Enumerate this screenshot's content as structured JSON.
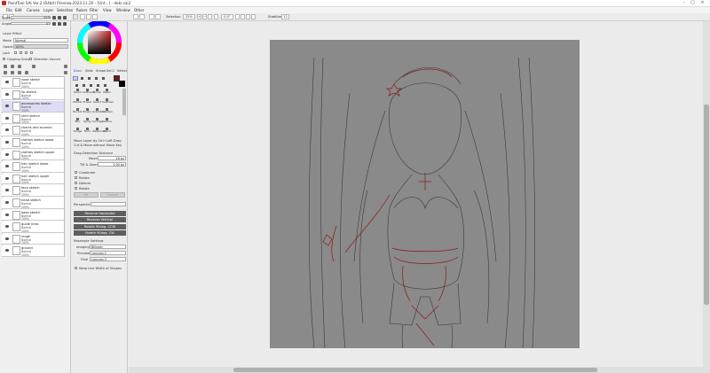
{
  "window": {
    "title": "PaintTool SAI Ver.2 (64bit) Preview.2023.11.20 - [Unt...] - dekr.sai2"
  },
  "menu": [
    "File",
    "Edit",
    "Canvas",
    "Layer",
    "Selection",
    "Rulers",
    "Filter",
    "View",
    "Window",
    "Other"
  ],
  "toolbar": {
    "selection_label": "Selection",
    "zoom": "25%",
    "angle": "0.0°",
    "stabilizer_label": "Stabilizer",
    "stabilizer_value": "12"
  },
  "left": {
    "scale_label": "Scale",
    "scale_value": "25%",
    "angle_label": "Angle",
    "angle_value": "0°",
    "layer_effect": "Layer Effect",
    "mode_label": "Mode",
    "mode_value": "Normal",
    "opacity_label": "Opacity",
    "opacity_value": "100%",
    "lock_label": "Lock",
    "clipping_label": "Clipping Group",
    "selection_source_label": "Selection Source",
    "layers": [
      {
        "name": "nose sketch",
        "mode": "Normal",
        "opacity": "100%"
      },
      {
        "name": "lip sketch",
        "mode": "Normal",
        "opacity": "100%"
      },
      {
        "name": "accessories sketch",
        "mode": "Normal",
        "opacity": "100%"
      },
      {
        "name": "shirt sketch",
        "mode": "Normal",
        "opacity": "100%"
      },
      {
        "name": "chains and accents",
        "mode": "Normal",
        "opacity": "100%"
      },
      {
        "name": "clothes sketch lower",
        "mode": "Normal",
        "opacity": "100%"
      },
      {
        "name": "clothes sketch upper",
        "mode": "Normal",
        "opacity": "100%"
      },
      {
        "name": "hair sketch lower",
        "mode": "Normal",
        "opacity": "100%"
      },
      {
        "name": "hair sketch upper",
        "mode": "Normal",
        "opacity": "100%"
      },
      {
        "name": "face sketch",
        "mode": "Normal",
        "opacity": "100%"
      },
      {
        "name": "head sketch",
        "mode": "Normal",
        "opacity": "100%"
      },
      {
        "name": "base sketch",
        "mode": "Normal",
        "opacity": "100%"
      },
      {
        "name": "guide lines",
        "mode": "Normal",
        "opacity": "100%"
      },
      {
        "name": "rough",
        "mode": "Normal",
        "opacity": "100%"
      },
      {
        "name": "ground",
        "mode": "Normal",
        "opacity": "100%"
      }
    ]
  },
  "tools": {
    "tabs": [
      "Basic",
      "Slide",
      "Shape",
      "Sel.2",
      "Select"
    ],
    "grid": [
      "Pencil",
      "AirBrush",
      "Brush",
      "Water",
      "Marker",
      "Eraser",
      "Select",
      "SelErase",
      "Bucket",
      "Binary",
      "Gradation",
      "Shadow",
      "Blur",
      "Spray",
      "Smudge",
      "Outline",
      "Dodge",
      "Burn",
      "Watercolor",
      "Blend"
    ],
    "move_layer": "Move Layer by Ctrl+Left Drag",
    "cut_move": "Cut & Move without Move Key",
    "drag_threshold": "Drag Detection Distance",
    "move_label": "Move",
    "move_value": "16 px",
    "tilt_label": "Tilt & Zoom",
    "tilt_value": "1.00 px",
    "options": [
      "Coodinate",
      "Rotate",
      "Deform",
      "Rotate"
    ],
    "ok": "OK",
    "cancel": "Cancel",
    "perspective_label": "Perspective",
    "buttons": [
      "Reverse Horizontal",
      "Reverse Vertical",
      "Rotate 90deg. CCW",
      "Rotate 90deg. CW"
    ],
    "resample_label": "Resample Settings",
    "imaging_label": "Imaging",
    "imaging_value": "Bilinear",
    "preview_label": "Preview",
    "preview_value": "Lanczos 2",
    "final_label": "Final",
    "final_value": "Lanczos 3",
    "keep_line": "Keep Line Width of Shapes"
  },
  "colors": {
    "primary": "#7a1515",
    "secondary": "#000000"
  }
}
